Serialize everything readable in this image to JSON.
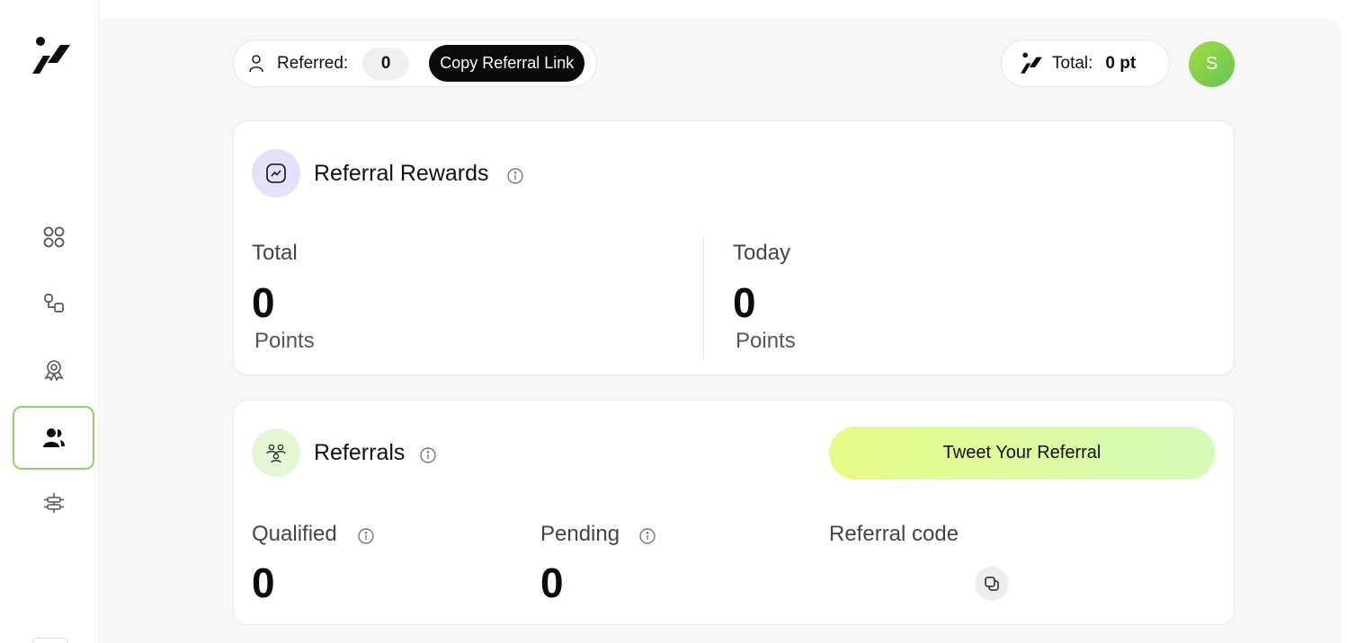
{
  "sidebar": {
    "logo_icon": "brand-logo-icon",
    "items": [
      {
        "icon": "grid-icon",
        "active": false
      },
      {
        "icon": "workflow-icon",
        "active": false
      },
      {
        "icon": "badge-icon",
        "active": false
      },
      {
        "icon": "users-icon",
        "active": true
      },
      {
        "icon": "sliders-icon",
        "active": false
      }
    ],
    "active_border_color": "#8ed16b"
  },
  "header": {
    "referred_label": "Referred:",
    "referred_count": "0",
    "copy_link_label": "Copy Referral Link",
    "total_label": "Total:",
    "total_value": "0 pt",
    "avatar_initial": "S"
  },
  "rewards": {
    "title": "Referral Rewards",
    "total_label": "Total",
    "total_value": "0",
    "total_unit": "Points",
    "today_label": "Today",
    "today_value": "0",
    "today_unit": "Points"
  },
  "referrals": {
    "title": "Referrals",
    "tweet_label": "Tweet Your Referral",
    "qualified_label": "Qualified",
    "qualified_value": "0",
    "pending_label": "Pending",
    "pending_value": "0",
    "code_label": "Referral code"
  },
  "colors": {
    "accent_green": "#8ed16b",
    "tweet_gradient_start": "#e6fb86",
    "tweet_gradient_end": "#d4fab8",
    "rewards_icon_bg": "#e5e1fb",
    "referrals_icon_bg": "#e5f7d4"
  }
}
